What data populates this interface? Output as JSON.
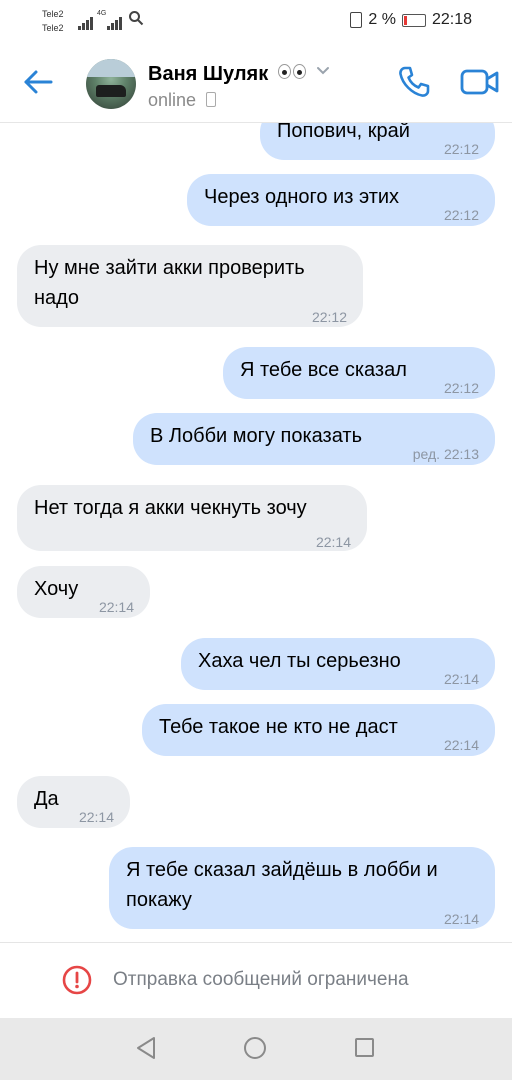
{
  "statusbar": {
    "carrier1": "Tele2",
    "carrier2": "Tele2",
    "network": "4G",
    "battery": "2 %",
    "time": "22:18"
  },
  "header": {
    "contact_name": "Ваня Шуляк",
    "status": "online"
  },
  "messages": [
    {
      "dir": "out",
      "text": "Попович, край",
      "time": "22:12"
    },
    {
      "dir": "out",
      "text": "Через одного из этих",
      "time": "22:12"
    },
    {
      "dir": "in",
      "text": "Ну мне зайти акки проверить надо",
      "time": "22:12"
    },
    {
      "dir": "out",
      "text": "Я тебе все сказал",
      "time": "22:12"
    },
    {
      "dir": "out",
      "text": "В Лобби могу показать",
      "time": "ред. 22:13"
    },
    {
      "dir": "in",
      "text": "Нет тогда я акки чекнуть зочу",
      "time": "22:14"
    },
    {
      "dir": "in",
      "text": "Хочу",
      "time": "22:14"
    },
    {
      "dir": "out",
      "text": "Хаха чел ты серьезно",
      "time": "22:14"
    },
    {
      "dir": "out",
      "text": "Тебе такое не кто не даст",
      "time": "22:14"
    },
    {
      "dir": "in",
      "text": "Да",
      "time": "22:14"
    },
    {
      "dir": "out",
      "text": "Я тебе сказал зайдёшь в лобби и покажу",
      "time": "22:14"
    }
  ],
  "footer": {
    "restriction_text": "Отправка сообщений ограничена"
  },
  "colors": {
    "accent": "#2a83d6",
    "outgoing_bubble": "#cfe2fd",
    "incoming_bubble": "#ebedf0",
    "warning": "#e64646"
  },
  "icons": {
    "back": "arrow-left-icon",
    "call": "phone-icon",
    "video": "video-camera-icon",
    "warning": "alert-circle-icon"
  }
}
